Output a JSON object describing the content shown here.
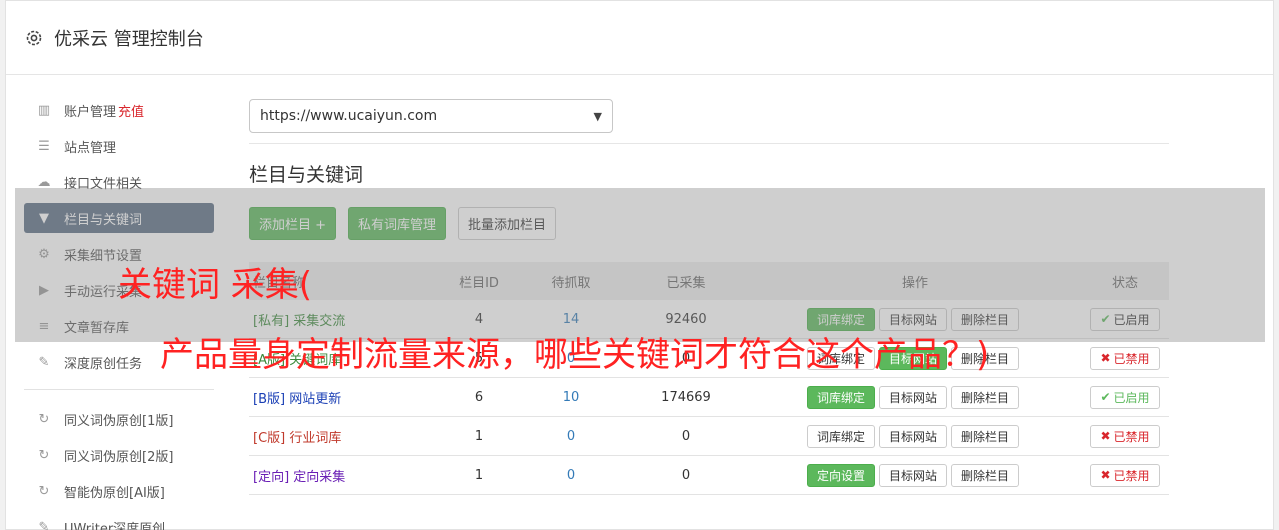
{
  "header": {
    "title": "优采云 管理控制台"
  },
  "sidebar": {
    "items": [
      {
        "label": "账户管理",
        "accent": "充值",
        "icon": "bar-chart-icon"
      },
      {
        "label": "站点管理",
        "icon": "server-icon"
      },
      {
        "label": "接口文件相关",
        "icon": "cloud-upload-icon"
      },
      {
        "label": "栏目与关键词",
        "icon": "filter-icon",
        "active": true
      },
      {
        "label": "采集细节设置",
        "icon": "gears-icon"
      },
      {
        "label": "手动运行采集",
        "icon": "play-icon"
      },
      {
        "label": "文章暂存库",
        "icon": "database-icon"
      },
      {
        "label": "深度原创任务",
        "icon": "edit-icon"
      }
    ],
    "items2": [
      {
        "label": "同义词伪原创[1版]",
        "icon": "refresh-icon"
      },
      {
        "label": "同义词伪原创[2版]",
        "icon": "refresh-icon"
      },
      {
        "label": "智能伪原创[AI版]",
        "icon": "refresh-icon"
      },
      {
        "label": "UWriter深度原创",
        "icon": "edit-icon"
      }
    ]
  },
  "main": {
    "site_select": "https://www.ucaiyun.com",
    "section_title": "栏目与关键词",
    "toolbar": {
      "add": "添加栏目 +",
      "private": "私有词库管理",
      "batch": "批量添加栏目"
    },
    "table": {
      "headers": {
        "name": "栏目名称",
        "id": "栏目ID",
        "pending": "待抓取",
        "collected": "已采集",
        "ops": "操作",
        "status": "状态"
      },
      "rows": [
        {
          "tag": "[私有]",
          "name": "采集交流",
          "id": "4",
          "pending": "14",
          "collected": "92460",
          "op1": "词库绑定",
          "op2": "目标网站",
          "op3": "删除栏目",
          "status": "已启用",
          "enabled": true
        },
        {
          "tag": "[A版]",
          "name": "关键词库",
          "id": "5",
          "pending": "0",
          "collected": "0",
          "op1": "词库绑定",
          "op2": "目标网站",
          "op3": "删除栏目",
          "status": "已禁用",
          "enabled": false
        },
        {
          "tag": "[B版]",
          "name": "网站更新",
          "id": "6",
          "pending": "10",
          "collected": "174669",
          "op1": "词库绑定",
          "op2": "目标网站",
          "op3": "删除栏目",
          "status": "已启用",
          "enabled": true
        },
        {
          "tag": "[C版]",
          "name": "行业词库",
          "id": "1",
          "pending": "0",
          "collected": "0",
          "op1": "词库绑定",
          "op2": "目标网站",
          "op3": "删除栏目",
          "status": "已禁用",
          "enabled": false
        },
        {
          "tag": "[定向]",
          "name": "定向采集",
          "id": "1",
          "pending": "0",
          "collected": "0",
          "op1": "定向设置",
          "op2": "目标网站",
          "op3": "删除栏目",
          "status": "已禁用",
          "enabled": false
        }
      ]
    }
  },
  "overlay": {
    "line1": "关键词 采集(",
    "line2": "产品量身定制流量来源，哪些关键词才符合这个产品？)"
  },
  "colors": {
    "green": "#5cb85c",
    "sidebar_active": "#5b6d84",
    "link": "#337ab7",
    "red": "#d9262c",
    "overlay_text": "#ff2222"
  }
}
